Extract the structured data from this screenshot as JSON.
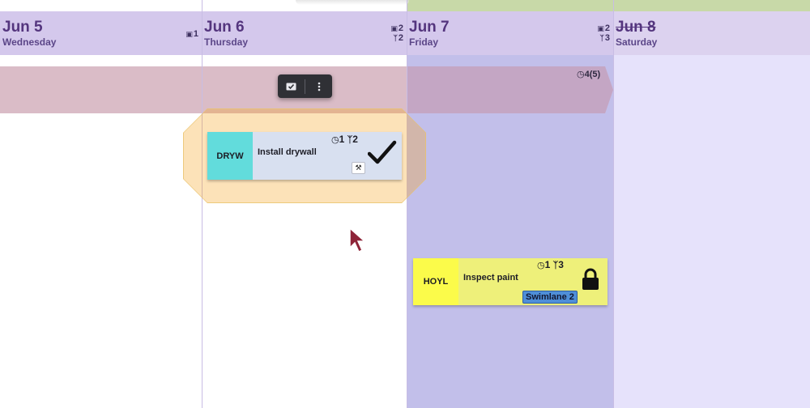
{
  "days": [
    {
      "title": "Jun 5",
      "weekday": "Wednesday",
      "stat1": "1",
      "stat2": "",
      "struck": false
    },
    {
      "title": "Jun 6",
      "weekday": "Thursday",
      "stat1": "2",
      "stat2": "2",
      "struck": false
    },
    {
      "title": "Jun 7",
      "weekday": "Friday",
      "stat1": "2",
      "stat2": "3",
      "struck": false
    },
    {
      "title": "Jun 8",
      "weekday": "Saturday",
      "stat1": "",
      "stat2": "",
      "struck": true
    }
  ],
  "band": {
    "count_label": "4(5)"
  },
  "toolbar": {
    "icons": [
      "checkbox-icon",
      "more-vertical-icon"
    ]
  },
  "tasks": [
    {
      "code": "DRYW",
      "title": "Install drywall",
      "stat_a": "1",
      "stat_b": "2",
      "status_icon": "check-icon",
      "tool_icon": "tool-icon",
      "code_color": "#62dcdc"
    },
    {
      "code": "HOYL",
      "title": "Inspect paint",
      "stat_a": "1",
      "stat_b": "3",
      "status_icon": "lock-icon",
      "swimlane": "Swimlane 2",
      "code_color": "#fbfb4a"
    }
  ],
  "colors": {
    "header": "#d4c8ec",
    "friday": "#c2bfea",
    "saturday": "#e6e2fb",
    "band": "#d8b8c4",
    "selection": "#f5a623"
  }
}
